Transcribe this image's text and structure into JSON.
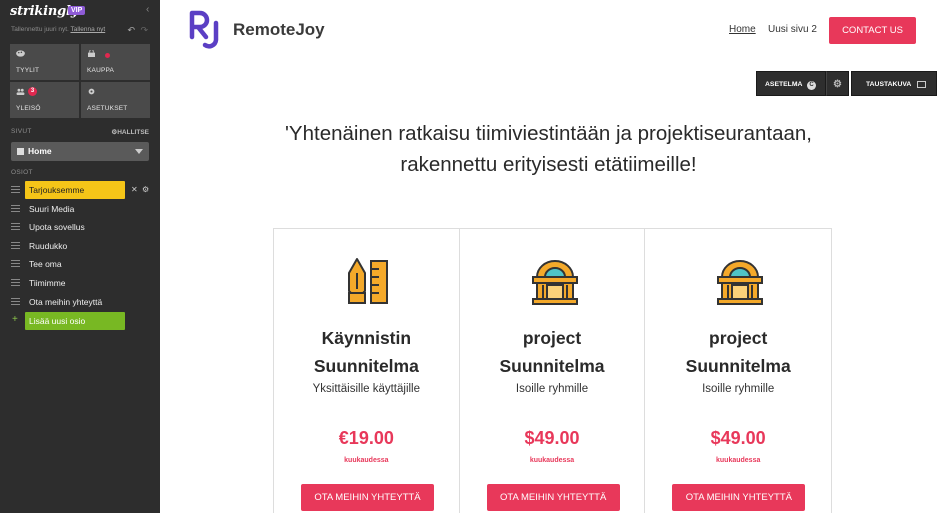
{
  "editor": {
    "logo": "strikingly",
    "vip_badge": "VIP",
    "save_status_prefix": "Tallennettu juuri nyt. ",
    "save_now_link": "Tallenna nyt",
    "tiles": [
      {
        "label": "TYYLIT",
        "icon": "palette-icon"
      },
      {
        "label": "KAUPPA",
        "icon": "shop-icon"
      },
      {
        "label": "YLEISÖ",
        "icon": "audience-icon",
        "badge": "3"
      },
      {
        "label": "ASETUKSET",
        "icon": "gear-icon"
      }
    ],
    "pages_heading": "SIVUT",
    "manage_label": "HALLITSE",
    "current_page": "Home",
    "sections_heading": "OSIOT",
    "sections": [
      {
        "label": "Tarjouksemme",
        "active": true
      },
      {
        "label": "Suuri Media"
      },
      {
        "label": "Upota sovellus"
      },
      {
        "label": "Ruudukko"
      },
      {
        "label": "Tee oma"
      },
      {
        "label": "Tiimimme"
      },
      {
        "label": "Ota meihin yhteyttä"
      }
    ],
    "add_section_label": "Lisää uusi osio",
    "colors": {
      "active_section": "#f5c518",
      "add_section": "#78b823",
      "sidebar_bg": "#2d2d2d"
    }
  },
  "site": {
    "brand_name": "RemoteJoy",
    "brand_initials": "RJ",
    "nav": [
      {
        "label": "Home"
      },
      {
        "label": "Uusi sivu 2"
      }
    ],
    "contact_button": "CONTACT US",
    "section_tools": {
      "layout_button": "ASETELMA",
      "background_button": "TAUSTAKUVA"
    },
    "headline_line1": "'Yhtenäinen ratkaisu tiimiviestintään ja projektiseurantaan,",
    "headline_line2": "rakennettu erityisesti etätiimeille!",
    "plans": [
      {
        "title_line1": "Käynnistin",
        "title_line2": "Suunnitelma",
        "subtitle": "Yksittäisille käyttäjille",
        "price": "€19.00",
        "period": "kuukaudessa",
        "cta": "OTA MEIHIN YHTEYTTÄ",
        "icon": "pen-ruler-icon"
      },
      {
        "title_line1": "project",
        "title_line2": "Suunnitelma",
        "subtitle": "Isoille ryhmille",
        "price": "$49.00",
        "period": "kuukaudessa",
        "cta": "OTA MEIHIN YHTEYTTÄ",
        "icon": "building-icon"
      },
      {
        "title_line1": "project",
        "title_line2": "Suunnitelma",
        "subtitle": "Isoille ryhmille",
        "price": "$49.00",
        "period": "kuukaudessa",
        "cta": "OTA MEIHIN YHTEYTTÄ",
        "icon": "building-icon"
      }
    ],
    "colors": {
      "accent": "#e8385a",
      "brand": "#5b3fc4",
      "icon_orange": "#f4a92a"
    }
  }
}
